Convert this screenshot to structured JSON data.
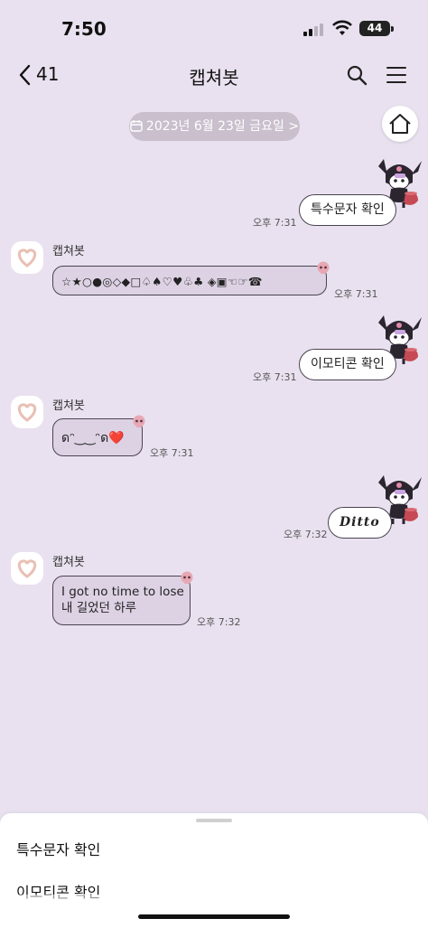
{
  "status_bar": {
    "time": "7:50",
    "battery": "44"
  },
  "header": {
    "back_count": "41",
    "title": "캡쳐봇"
  },
  "date_divider": "2023년 6월 23일 금요일 >",
  "messages": [
    {
      "dir": "out",
      "text": "특수문자 확인",
      "time": "오후 7:31"
    },
    {
      "dir": "in",
      "sender": "캡쳐봇",
      "text": "☆★○●◎◇◆□♤♠♡♥♧♣ ◈▣☜☞☎",
      "time": "오후 7:31"
    },
    {
      "dir": "out",
      "text": "이모티콘 확인",
      "time": "오후 7:31"
    },
    {
      "dir": "in",
      "sender": "캡쳐봇",
      "text": "ดᵔ‿‿ᵔด❤️",
      "time": "오후 7:31"
    },
    {
      "dir": "out",
      "text": "Ditto",
      "time": "오후 7:32"
    },
    {
      "dir": "in",
      "sender": "캡쳐봇",
      "line1": "I got no time to lose",
      "line2": "내 길었던 하루",
      "time": "오후 7:32"
    }
  ],
  "quick_replies": [
    "특수문자 확인",
    "이모티콘 확인"
  ],
  "colors": {
    "background": "#e9e1ef",
    "bubble_in": "#ddd2e4",
    "bubble_out": "#ffffff",
    "date_pill": "#c9bfcd"
  },
  "icons": [
    "back-chevron",
    "search",
    "hamburger-menu",
    "home",
    "calendar",
    "kuromi-sticker",
    "heart-avatar",
    "skull"
  ]
}
